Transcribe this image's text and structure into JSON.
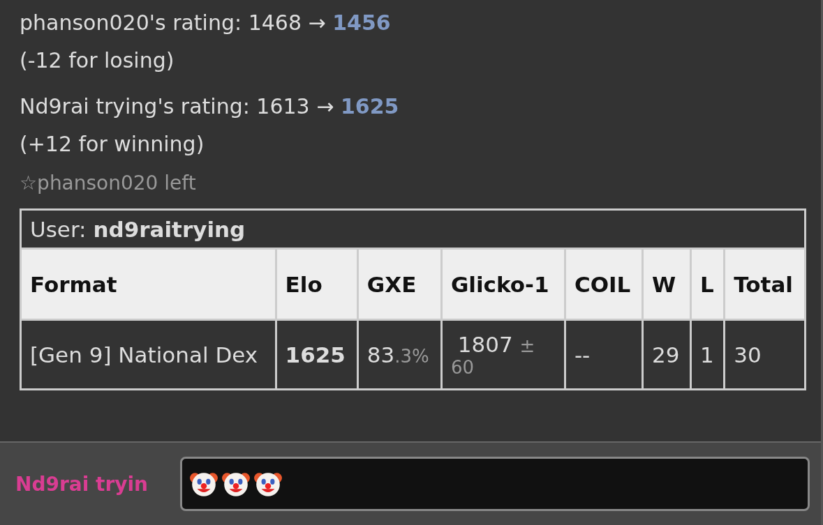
{
  "messages": [
    {
      "kind": "rating",
      "text": "phanson020's rating: 1468 → ",
      "new_rating": "1456",
      "note": "(-12 for losing)"
    },
    {
      "kind": "rating",
      "text": "Nd9rai trying's rating: 1613 → ",
      "new_rating": "1625",
      "note": "(+12 for winning)"
    },
    {
      "kind": "notice",
      "text": "☆phanson020 left"
    }
  ],
  "rank_table": {
    "user_label": "User: ",
    "user": "nd9raitrying",
    "columns": [
      "Format",
      "Elo",
      "GXE",
      "Glicko-1",
      "COIL",
      "W",
      "L",
      "Total"
    ],
    "rows": [
      {
        "format": "[Gen 9] National Dex",
        "elo": "1625",
        "gxe": "83",
        "gxe_decimal": ".3%",
        "glicko": "1807",
        "glicko_deviation": "± 60",
        "coil": "--",
        "w": "29",
        "l": "1",
        "total": "30"
      }
    ]
  },
  "compose": {
    "name": "Nd9rai tryin"
  }
}
